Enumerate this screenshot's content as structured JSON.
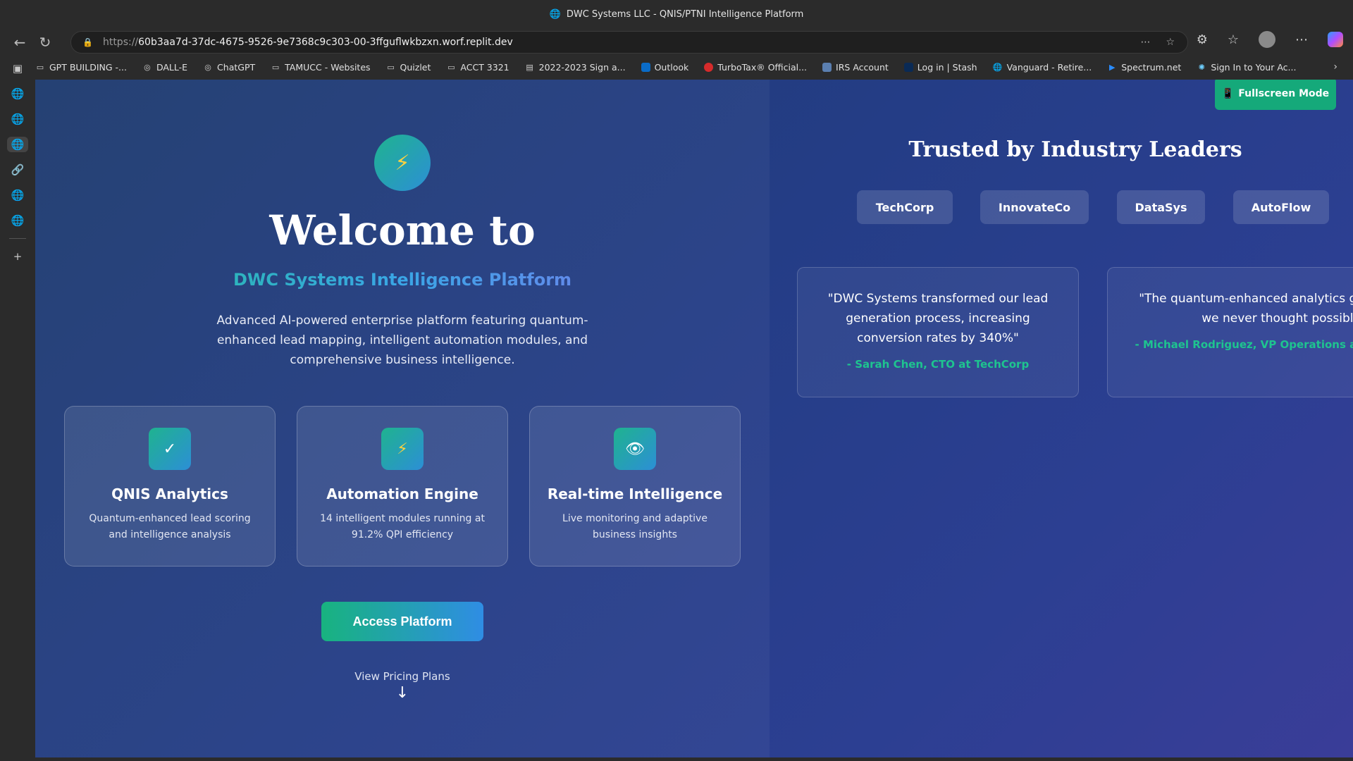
{
  "browser": {
    "window_title": "DWC Systems LLC - QNIS/PTNI Intelligence Platform",
    "url_prefix": "https://",
    "url_host": "60b3aa7d-37dc-4675-9526-9e7368c9c303-00-3ffguflwkbzxn.worf.replit.dev",
    "bookmarks": [
      {
        "label": "GPT BUILDING -...",
        "icon": "folder-icon"
      },
      {
        "label": "DALL-E",
        "icon": "openai-icon"
      },
      {
        "label": "ChatGPT",
        "icon": "openai-icon"
      },
      {
        "label": "TAMUCC - Websites",
        "icon": "folder-icon"
      },
      {
        "label": "Quizlet",
        "icon": "folder-icon"
      },
      {
        "label": "ACCT 3321",
        "icon": "folder-icon"
      },
      {
        "label": "2022-2023 Sign a...",
        "icon": "document-icon"
      },
      {
        "label": "Outlook",
        "icon": "outlook-icon"
      },
      {
        "label": "TurboTax® Official...",
        "icon": "turbotax-icon"
      },
      {
        "label": "IRS Account",
        "icon": "irs-icon"
      },
      {
        "label": "Log in | Stash",
        "icon": "stash-icon"
      },
      {
        "label": "Vanguard - Retire...",
        "icon": "globe-icon"
      },
      {
        "label": "Spectrum.net",
        "icon": "play-icon"
      },
      {
        "label": "Sign In to Your Ac...",
        "icon": "star-burst-icon"
      }
    ]
  },
  "hero": {
    "icon": "lightning-icon",
    "title": "Welcome to",
    "subtitle": "DWC Systems Intelligence Platform",
    "description": "Advanced AI-powered enterprise platform featuring quantum-enhanced lead mapping, intelligent automation modules, and comprehensive business intelligence."
  },
  "features": [
    {
      "icon": "checkmark-icon",
      "glyph": "✓",
      "title": "QNIS Analytics",
      "description": "Quantum-enhanced lead scoring and intelligence analysis"
    },
    {
      "icon": "lightning-icon",
      "glyph": "⚡",
      "title": "Automation Engine",
      "description": "14 intelligent modules running at 91.2% QPI efficiency"
    },
    {
      "icon": "eye-icon",
      "glyph": "👁",
      "title": "Real-time Intelligence",
      "description": "Live monitoring and adaptive business insights"
    }
  ],
  "cta": {
    "access_label": "Access Platform",
    "pricing_label": "View Pricing Plans",
    "pricing_arrow": "↓"
  },
  "fullscreen": {
    "icon": "phone-icon",
    "label": "Fullscreen Mode"
  },
  "trusted": {
    "title": "Trusted by Industry Leaders",
    "logos": [
      "TechCorp",
      "InnovateCo",
      "DataSys",
      "AutoFlow"
    ]
  },
  "testimonials": [
    {
      "quote": "\"DWC Systems transformed our lead generation process, increasing conversion rates by 340%\"",
      "author": "- Sarah Chen, CTO at TechCorp"
    },
    {
      "quote": "\"The quantum-enhanced analytics gave insights we never thought possible\"",
      "author": "- Michael Rodriguez, VP Operations at InnovateCo"
    }
  ],
  "colors": {
    "accent_green": "#1ec48f",
    "accent_blue": "#2f8de4",
    "background": "#243d86"
  }
}
